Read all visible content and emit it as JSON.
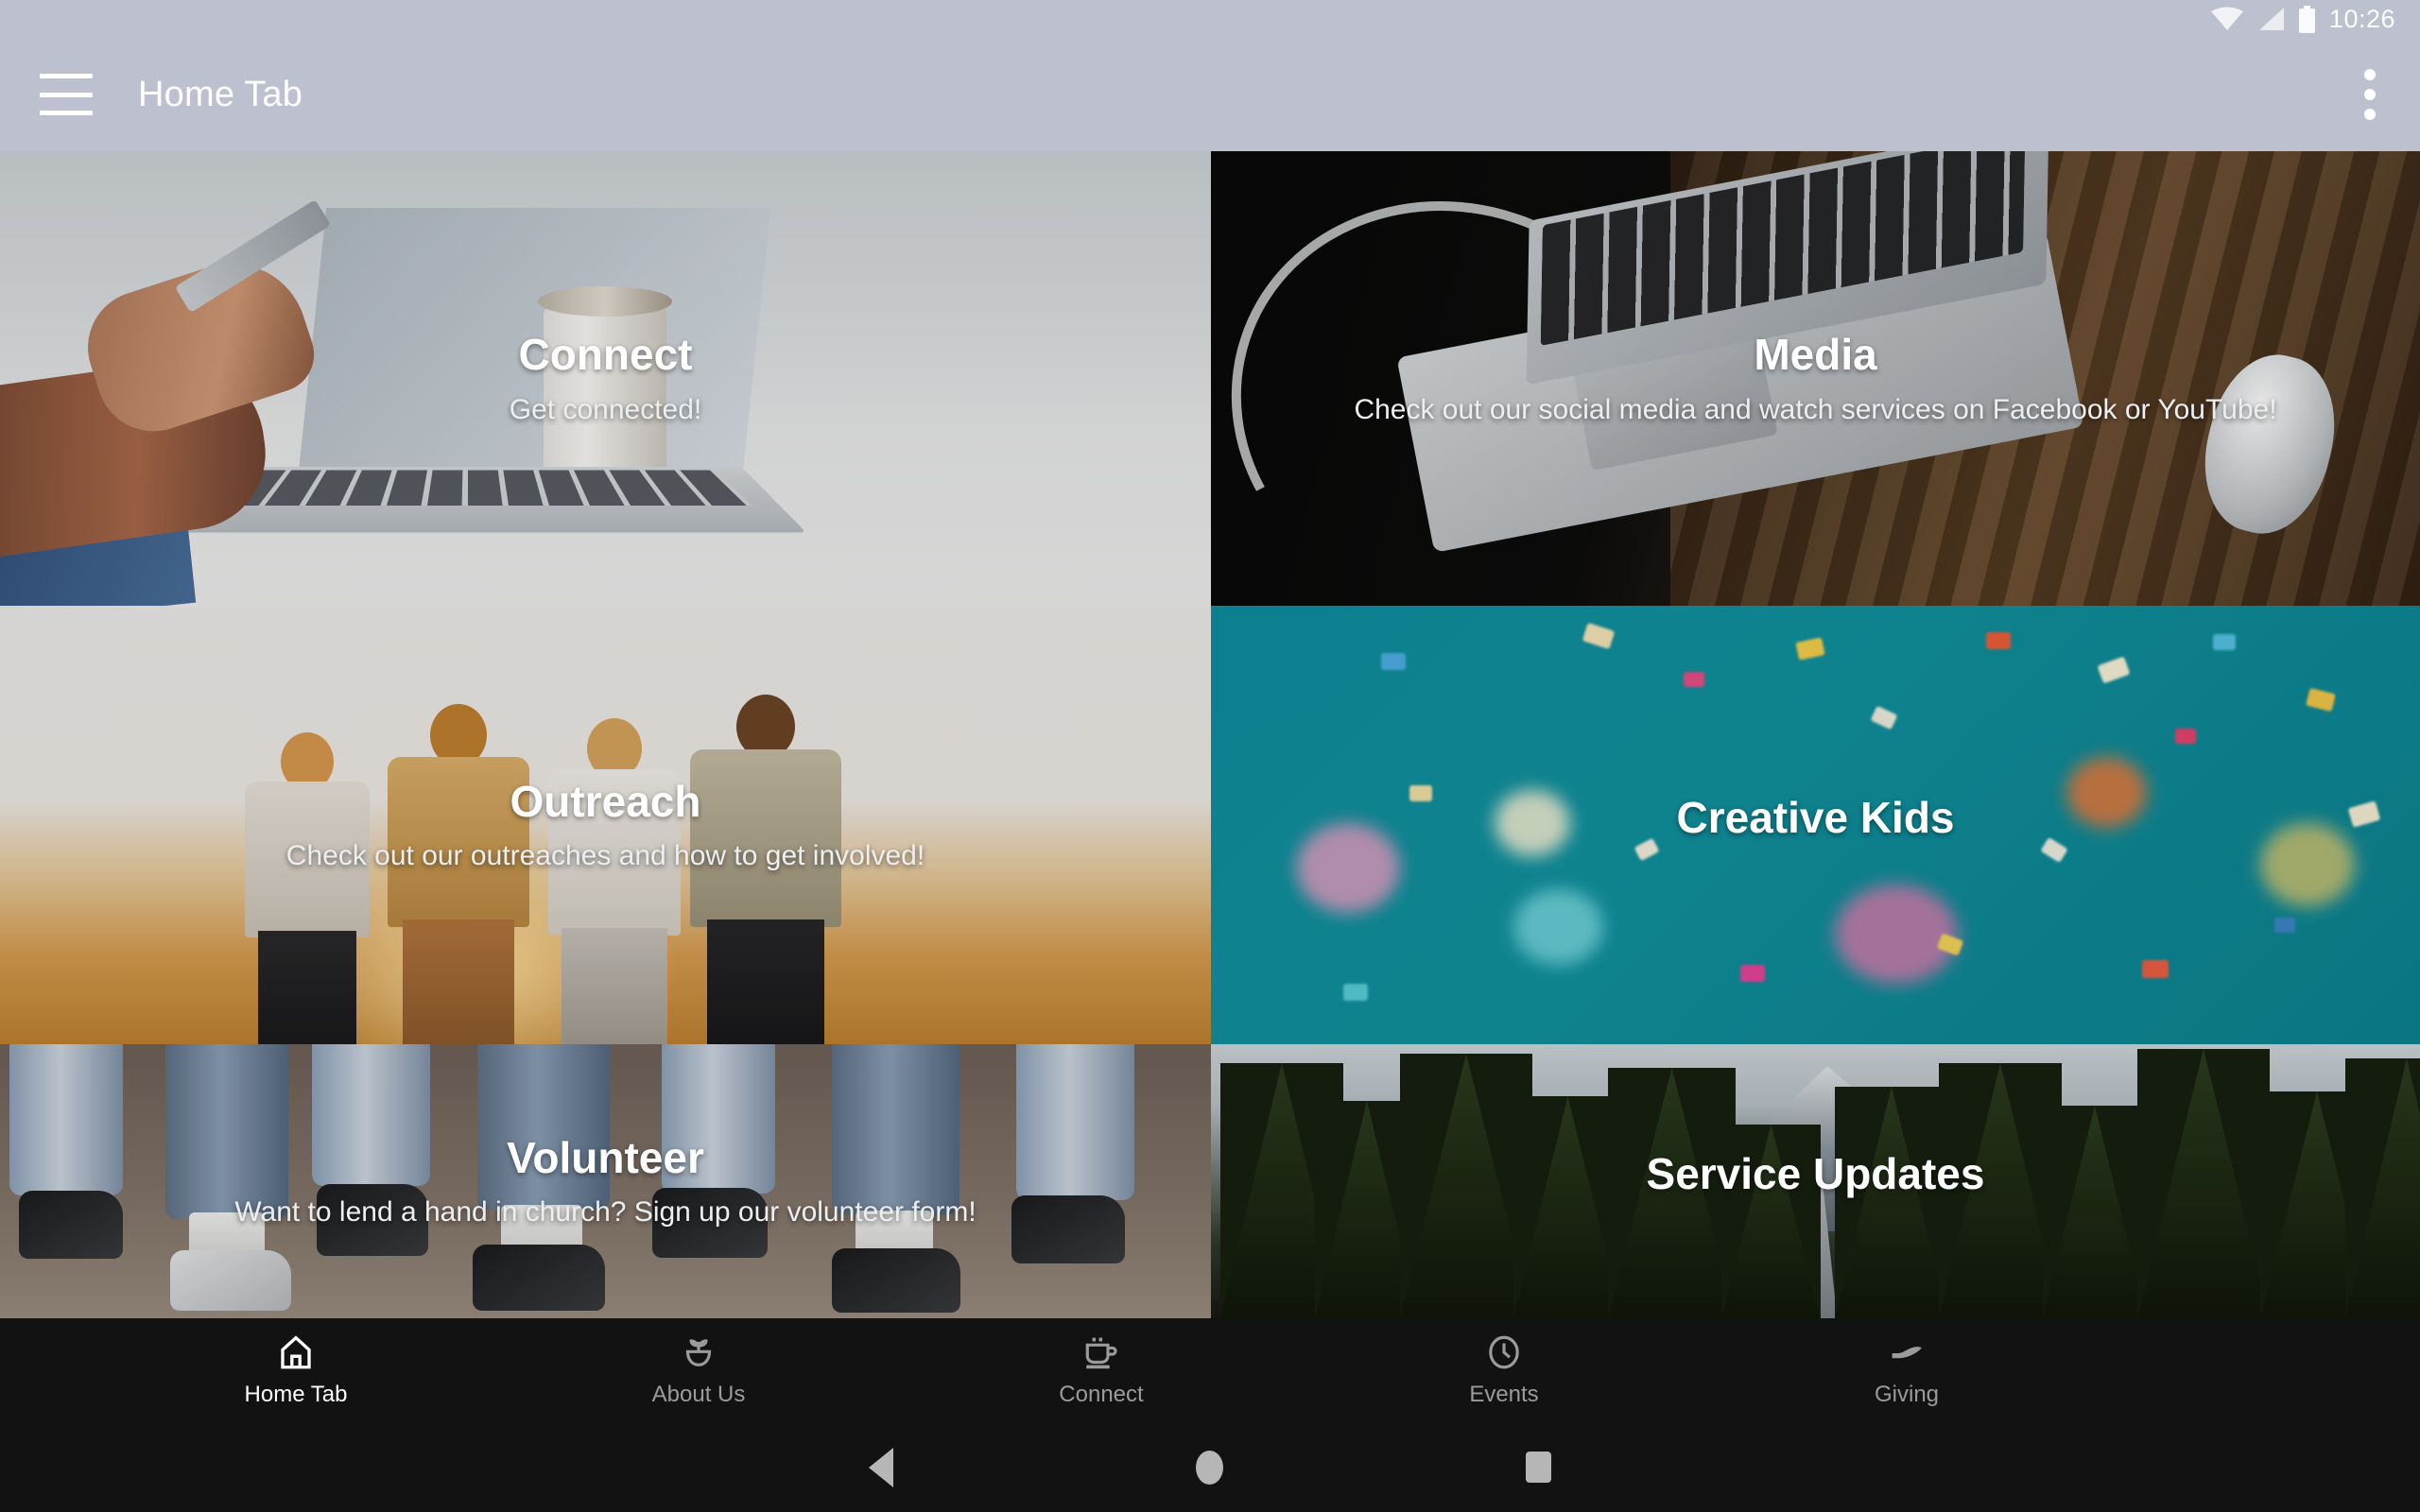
{
  "statusbar": {
    "time": "10:26",
    "icons": [
      "wifi-icon",
      "cell-signal-icon",
      "battery-icon"
    ]
  },
  "appbar": {
    "menu_icon": "hamburger-menu-icon",
    "title": "Home Tab",
    "overflow_icon": "overflow-menu-icon"
  },
  "tiles": [
    {
      "title": "Connect",
      "subtitle": "Get connected!"
    },
    {
      "title": "Media",
      "subtitle": "Check out our social media and watch services on Facebook or YouTube!"
    },
    {
      "title": "Outreach",
      "subtitle": "Check out our outreaches and how to get involved!"
    },
    {
      "title": "Creative Kids",
      "subtitle": ""
    },
    {
      "title": "Volunteer",
      "subtitle": "Want to lend a hand in church? Sign up our volunteer form!"
    },
    {
      "title": "Service Updates",
      "subtitle": ""
    }
  ],
  "bottom_nav": {
    "items": [
      {
        "label": "Home Tab",
        "icon": "home-icon",
        "active": true
      },
      {
        "label": "About Us",
        "icon": "sprout-icon",
        "active": false
      },
      {
        "label": "Connect",
        "icon": "coffee-cup-icon",
        "active": false
      },
      {
        "label": "Events",
        "icon": "clock-icon",
        "active": false
      },
      {
        "label": "Giving",
        "icon": "open-hand-icon",
        "active": false
      }
    ]
  },
  "system_nav": {
    "back": "back-triangle-icon",
    "home": "home-circle-icon",
    "recents": "recents-square-icon"
  },
  "colors": {
    "appbar": "#bdc0ce",
    "bottom_nav_bg": "#121212",
    "active_nav": "#ffffff",
    "inactive_nav": "#9b9b9b",
    "kids_tile": "#0f8fa0"
  }
}
